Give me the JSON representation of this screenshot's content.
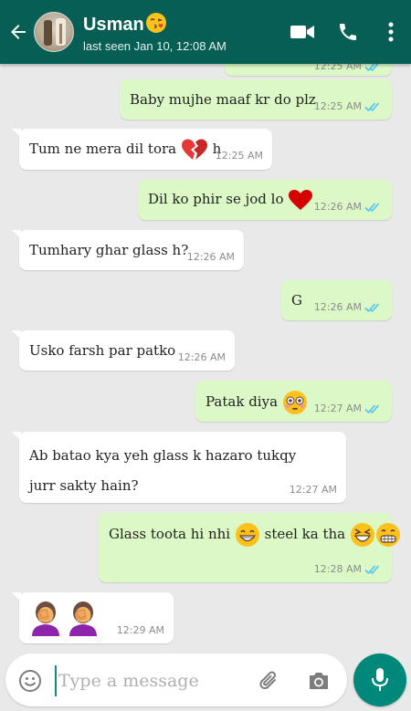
{
  "header": {
    "contact_name": "Usman",
    "name_emoji": "face-blowing-kiss-emoji",
    "status": "last seen Jan 10, 12:08 AM",
    "colors": {
      "bar": "#075e54",
      "text": "#ffffff"
    },
    "icons": [
      "back-arrow-icon",
      "video-call-icon",
      "voice-call-icon",
      "more-options-icon"
    ]
  },
  "messages": [
    {
      "id": "m0",
      "direction": "out",
      "text": "",
      "time": "12:25 AM",
      "ticks": "read",
      "partial": true
    },
    {
      "id": "m1",
      "direction": "out",
      "text": "Baby mujhe maaf kr do plz",
      "time": "12:25 AM",
      "ticks": "read"
    },
    {
      "id": "m2",
      "direction": "in",
      "text_a": "Tum ne mera dil tora",
      "emoji": "broken-heart-emoji",
      "text_b": "h",
      "time": "12:25 AM"
    },
    {
      "id": "m3",
      "direction": "out",
      "text": "Dil ko phir se jod lo",
      "emoji": "red-heart-emoji",
      "time": "12:26 AM",
      "ticks": "read"
    },
    {
      "id": "m4",
      "direction": "in",
      "text": "Tumhary ghar glass h?",
      "time": "12:26 AM"
    },
    {
      "id": "m5",
      "direction": "out",
      "text": "G",
      "time": "12:26 AM",
      "ticks": "read"
    },
    {
      "id": "m6",
      "direction": "in",
      "text": "Usko farsh par patko",
      "time": "12:26 AM"
    },
    {
      "id": "m7",
      "direction": "out",
      "text": "Patak diya",
      "emoji": "flushed-face-emoji",
      "time": "12:27 AM",
      "ticks": "read"
    },
    {
      "id": "m8",
      "direction": "in",
      "text": "Ab batao kya yeh glass k hazaro tukqy jurr sakty hain?",
      "time": "12:27 AM"
    },
    {
      "id": "m9",
      "direction": "out",
      "text_a": "Glass toota hi nhi",
      "emoji_a": "grinning-face-emoji",
      "text_b": "steel ka tha",
      "emoji_b": [
        "grinning-squinting-face-emoji",
        "grimacing-face-emoji"
      ],
      "time": "12:28 AM",
      "ticks": "read"
    },
    {
      "id": "m10",
      "direction": "in",
      "emojis": [
        "woman-facepalming-emoji",
        "woman-facepalming-emoji"
      ],
      "time": "12:29 AM"
    }
  ],
  "input": {
    "placeholder": "Type a message",
    "value": "",
    "icons": [
      "emoji-icon",
      "attach-icon",
      "camera-icon",
      "mic-icon"
    ]
  },
  "colors": {
    "chat_bg": "#e9e9e9",
    "incoming_bubble": "#ffffff",
    "outgoing_bubble": "#dcf8c6",
    "read_ticks": "#4fc3f7",
    "mic_button": "#00897b"
  }
}
